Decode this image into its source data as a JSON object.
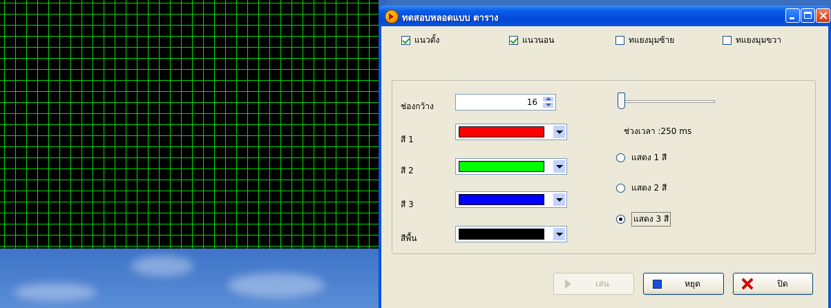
{
  "window": {
    "title": "ทดสอบหลอดแบบ ตาราง"
  },
  "options": {
    "vertical": {
      "label": "แนวตั้ง",
      "checked": true
    },
    "horizontal": {
      "label": "แนวนอน",
      "checked": true
    },
    "diag_left": {
      "label": "ทแยงมุมซ้าย",
      "checked": false
    },
    "diag_right": {
      "label": "ทแยงมุมขวา",
      "checked": false
    }
  },
  "settings": {
    "width_label": "ช่องกว้าง",
    "width_value": "16",
    "color1_label": "สี 1",
    "color2_label": "สี 2",
    "color3_label": "สี 3",
    "bg_label": "สีพื้น",
    "colors": {
      "color1": "#ff0000",
      "color2": "#00ff00",
      "color3": "#0000ff",
      "background": "#000000",
      "grid_line": "#00dd00"
    },
    "interval_label": "ช่วงเวลา :250 ms",
    "slider_level": 0
  },
  "modes": {
    "show1": {
      "label": "แสดง 1 สี",
      "selected": false
    },
    "show2": {
      "label": "แสดง 2 สี",
      "selected": false
    },
    "show3": {
      "label": "แสดง 3 สี",
      "selected": true
    }
  },
  "buttons": {
    "play": "เล่น",
    "stop": "หยุด",
    "close": "ปิด"
  }
}
